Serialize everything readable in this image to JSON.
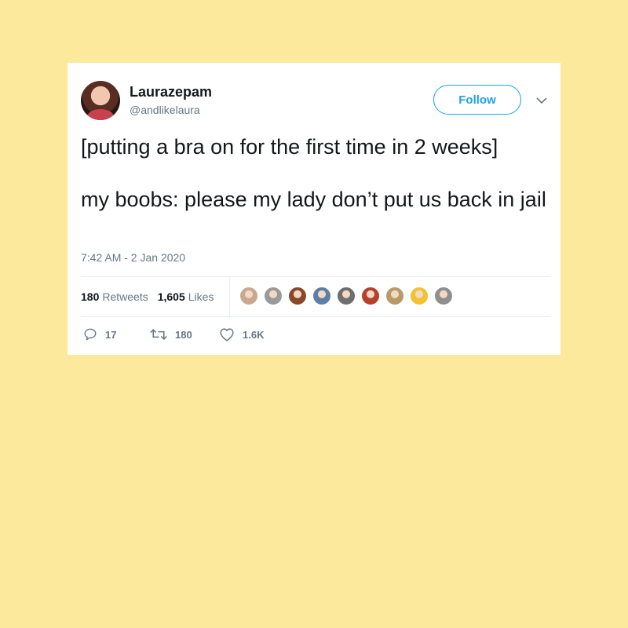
{
  "user": {
    "display_name": "Laurazepam",
    "handle": "@andlikelaura"
  },
  "follow_label": "Follow",
  "tweet": {
    "line1": "[putting a bra on for the first time in 2 weeks]",
    "line2": "my boobs: please my lady don’t put us back in jail"
  },
  "timestamp": "7:42 AM - 2 Jan 2020",
  "stats": {
    "retweets_count": "180",
    "retweets_label": "Retweets",
    "likes_count": "1,605",
    "likes_label": "Likes"
  },
  "actions": {
    "replies": "17",
    "retweets": "180",
    "likes": "1.6K"
  },
  "colors": {
    "background": "#fde99b",
    "accent": "#1da1f2",
    "muted": "#657786"
  },
  "liker_avatar_colors": [
    "#c9a88f",
    "#9a9a9a",
    "#8a4a2a",
    "#5b7fa6",
    "#6e6e6e",
    "#b8402a",
    "#b59a6a",
    "#f2c230",
    "#8f8f8f"
  ]
}
